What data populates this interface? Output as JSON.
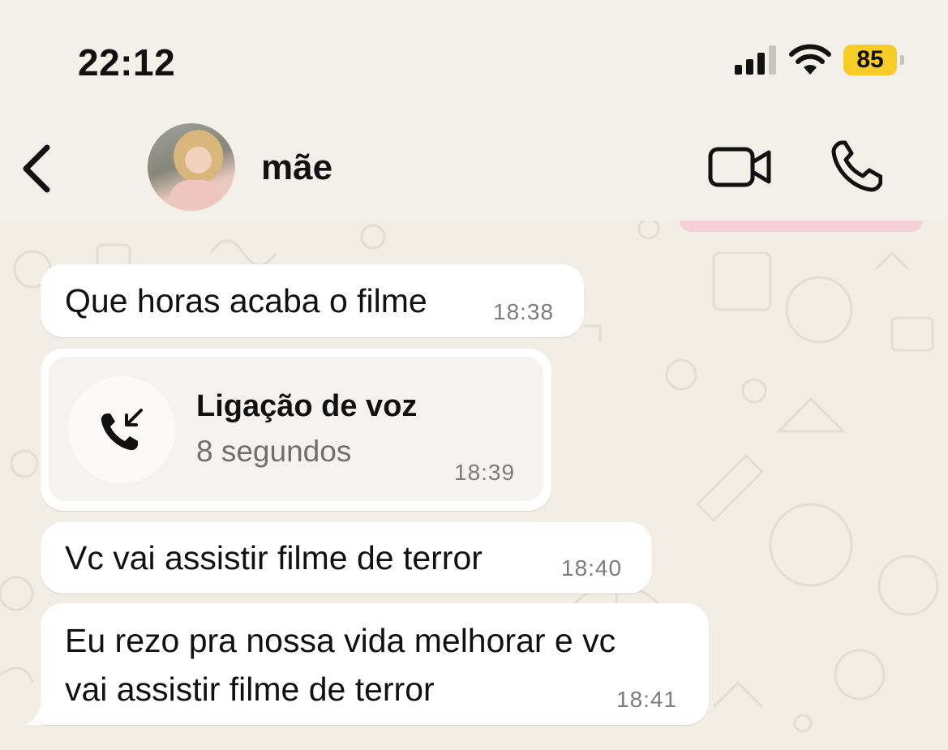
{
  "status_bar": {
    "time": "22:12",
    "battery_level": "85",
    "battery_color": "#f7cb28"
  },
  "header": {
    "contact_name": "mãe",
    "icons": [
      "back-chevron-icon",
      "video-camera-icon",
      "phone-icon"
    ]
  },
  "messages": [
    {
      "type": "text",
      "text": "Que horas acaba o filme",
      "time": "18:38"
    },
    {
      "type": "call",
      "title": "Ligação de voz",
      "subtitle": "8 segundos",
      "time": "18:39",
      "icon": "incoming-call-icon"
    },
    {
      "type": "text",
      "text": "Vc vai assistir filme de terror",
      "time": "18:40"
    },
    {
      "type": "text",
      "text_line1": "Eu rezo pra nossa vida melhorar e vc",
      "text_line2": "vai assistir filme de terror",
      "time": "18:41"
    }
  ]
}
